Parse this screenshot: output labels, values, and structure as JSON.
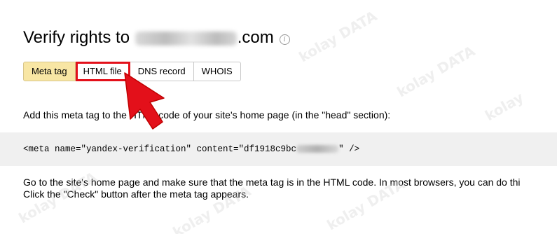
{
  "title": {
    "prefix": "Verify rights to",
    "suffix": ".com",
    "info_glyph": "i"
  },
  "tabs": [
    {
      "label": "Meta tag",
      "active": true
    },
    {
      "label": "HTML file",
      "highlighted": true
    },
    {
      "label": "DNS record"
    },
    {
      "label": "WHOIS"
    }
  ],
  "instruction": "Add this meta tag to the HTML code of your site's home page (in the \"head\" section):",
  "code": {
    "before": "<meta name=\"yandex-verification\" content=\"df1918c9bc",
    "after": "\" />"
  },
  "note": {
    "line1": "Go to the site's home page and make sure that the meta tag is in the HTML code. In most browsers, you can do thi",
    "line2": "Click the \"Check\" button after the meta tag appears."
  },
  "watermark": {
    "word": "kolay",
    "badge": "DATA"
  },
  "colors": {
    "active_tab": "#f8e6a4",
    "highlight": "#e3101a",
    "arrow": "#e3101a",
    "code_bg": "#f0f0f0"
  },
  "icons": {
    "info": "info-circle-icon",
    "pointer": "red-arrow-pointer-icon"
  }
}
